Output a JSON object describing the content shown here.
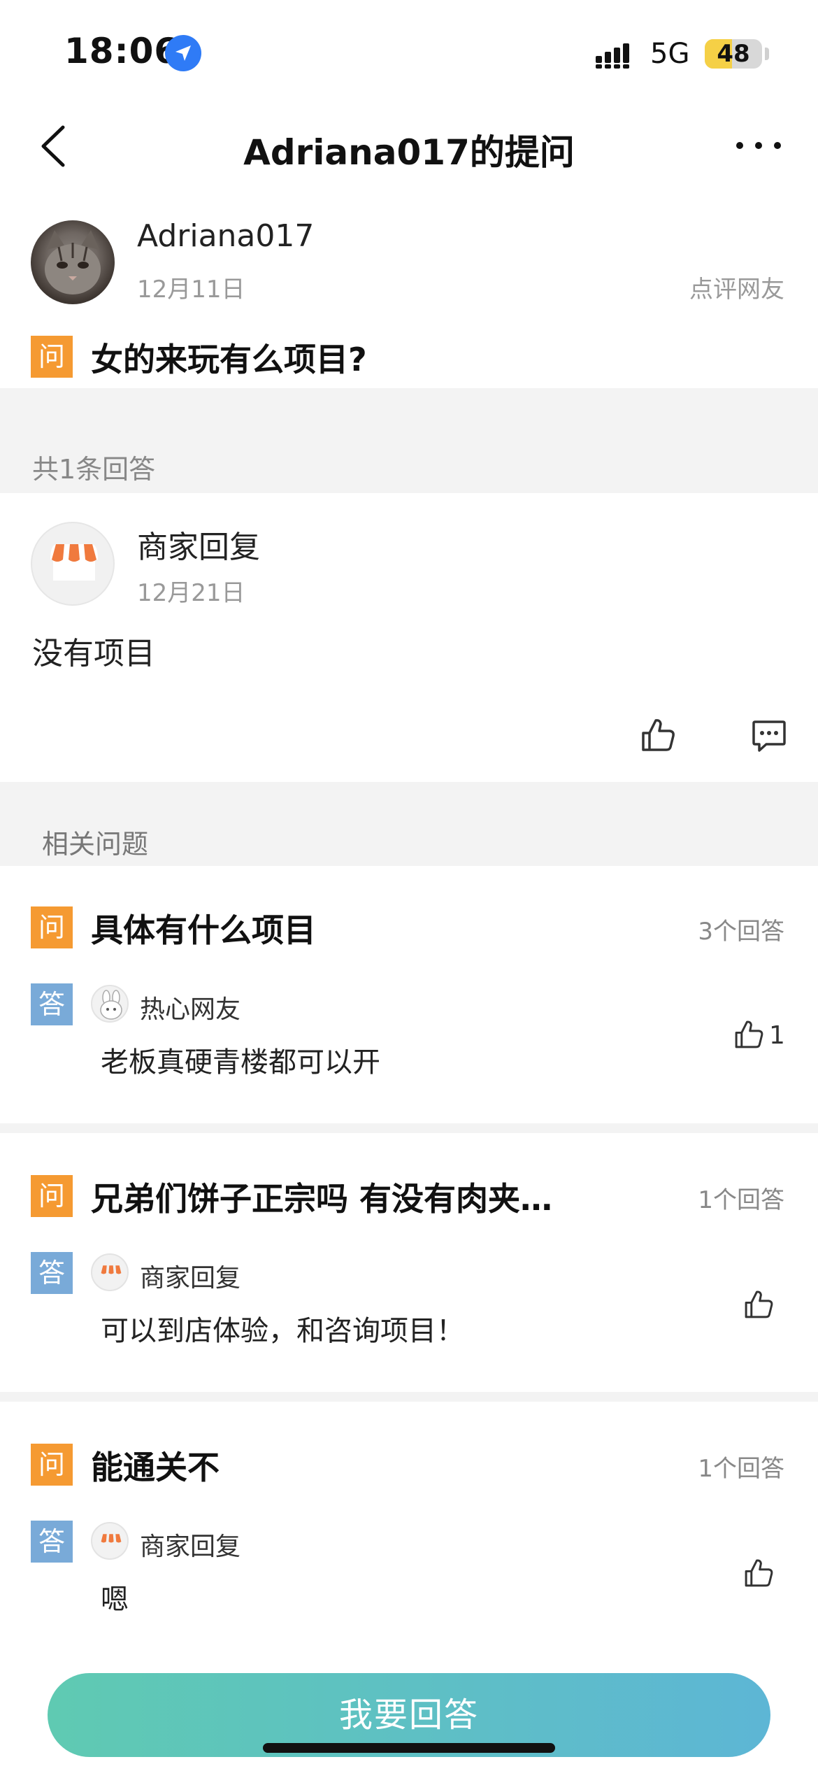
{
  "status_bar": {
    "time": "18:06",
    "network": "5G",
    "battery_level": "48"
  },
  "nav": {
    "title": "Adriana017的提问"
  },
  "question": {
    "author": "Adriana017",
    "date": "12月11日",
    "source": "点评网友",
    "badge": "问",
    "text": "女的来玩有么项目?"
  },
  "answers_section": {
    "count_label": "共1条回答",
    "answer": {
      "author": "商家回复",
      "date": "12月21日",
      "text": "没有项目"
    }
  },
  "related": {
    "label": "相关问题",
    "items": [
      {
        "q_badge": "问",
        "question": "具体有什么项目",
        "answer_count": "3个回答",
        "a_badge": "答",
        "author": "热心网友",
        "answer": "老板真硬青楼都可以开",
        "likes": "1"
      },
      {
        "q_badge": "问",
        "question": "兄弟们饼子正宗吗 有没有肉夹…",
        "answer_count": "1个回答",
        "a_badge": "答",
        "author": "商家回复",
        "answer": "可以到店体验，和咨询项目！",
        "likes": ""
      },
      {
        "q_badge": "问",
        "question": "能通关不",
        "answer_count": "1个回答",
        "a_badge": "答",
        "author": "商家回复",
        "answer": "嗯",
        "likes": ""
      }
    ]
  },
  "bottom": {
    "answer_button": "我要回答"
  },
  "colors": {
    "question_badge": "#f59a32",
    "answer_badge": "#79aad8",
    "button_start": "#5fcab2",
    "button_end": "#5db6d5"
  }
}
